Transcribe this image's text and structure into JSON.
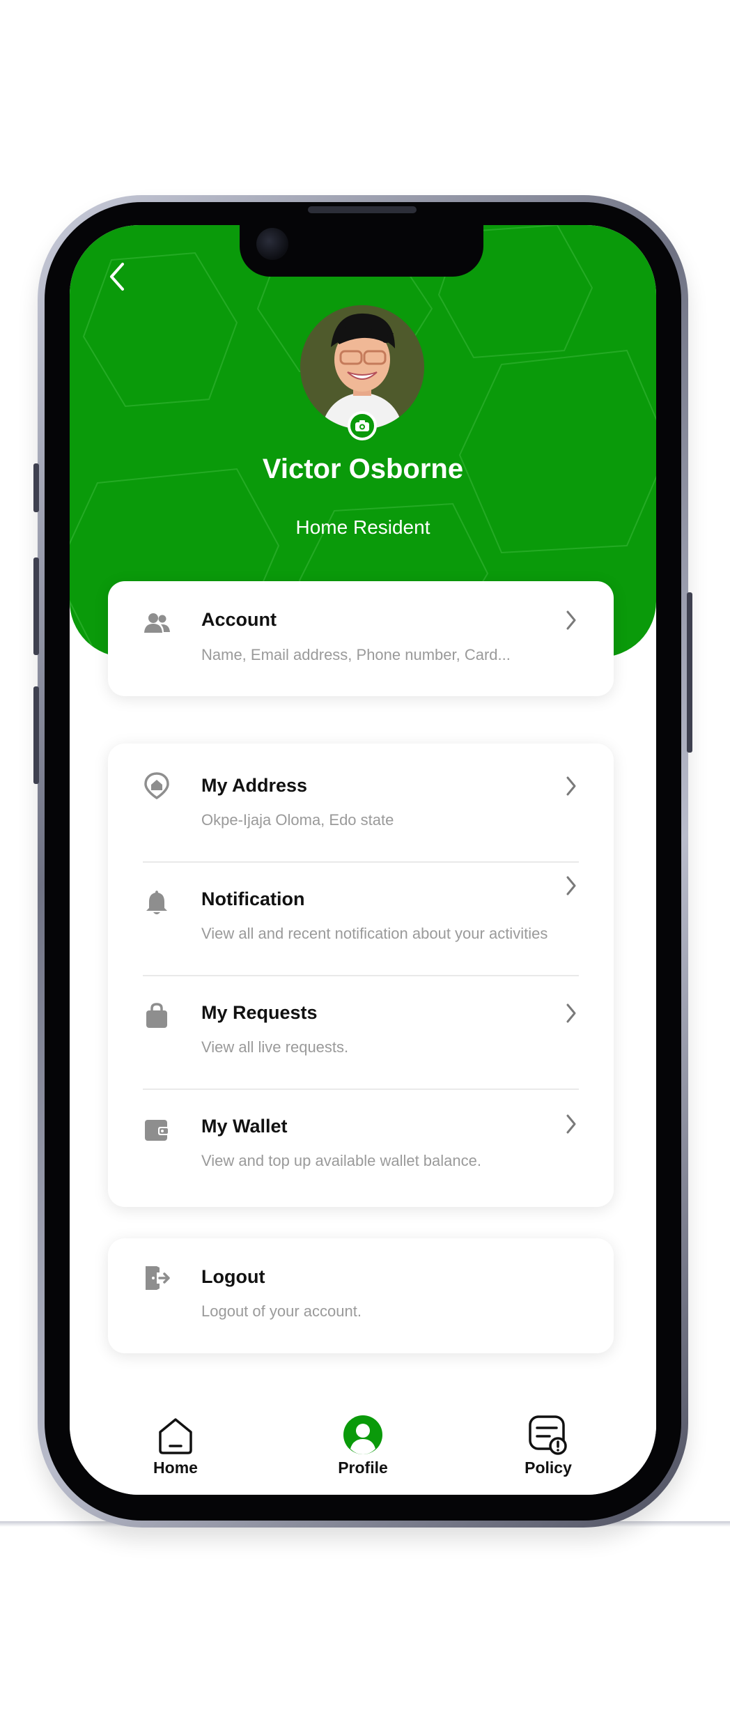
{
  "colors": {
    "brand_green": "#0a9a0a",
    "text_dark": "#111111",
    "text_muted": "#9a9a9a",
    "icon_gray": "#8e8e8e"
  },
  "header": {
    "back_icon": "chevron-left-icon",
    "user_name": "Victor Osborne",
    "user_role": "Home Resident",
    "avatar_icon": "avatar",
    "camera_icon": "camera-icon"
  },
  "account_card": {
    "icon": "users-icon",
    "title": "Account",
    "subtitle": "Name, Email address, Phone number, Card..."
  },
  "menu_card": {
    "items": [
      {
        "icon": "home-pin-icon",
        "title": "My Address",
        "subtitle": "Okpe-Ijaja Oloma, Edo state"
      },
      {
        "icon": "bell-icon",
        "title": "Notification",
        "subtitle": "View all and recent notification about your activities"
      },
      {
        "icon": "bag-icon",
        "title": "My Requests",
        "subtitle": "View all live requests."
      },
      {
        "icon": "wallet-icon",
        "title": "My Wallet",
        "subtitle": "View and top up available wallet balance."
      }
    ]
  },
  "logout_card": {
    "icon": "logout-icon",
    "title": "Logout",
    "subtitle": "Logout of your account."
  },
  "bottom_nav": {
    "items": [
      {
        "label": "Home",
        "icon": "home-icon",
        "active": false
      },
      {
        "label": "Profile",
        "icon": "profile-icon",
        "active": true
      },
      {
        "label": "Policy",
        "icon": "policy-icon",
        "active": false
      }
    ]
  }
}
